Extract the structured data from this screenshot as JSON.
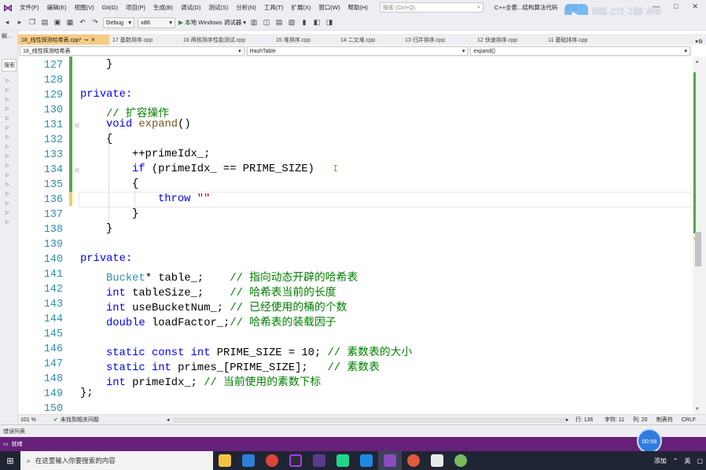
{
  "menubar": {
    "items": [
      "文件(F)",
      "编辑(E)",
      "视图(V)",
      "Git(G)",
      "项目(P)",
      "生成(B)",
      "调试(D)",
      "测试(S)",
      "分析(N)",
      "工具(T)",
      "扩展(X)",
      "窗口(W)",
      "帮助(H)"
    ],
    "search_placeholder": "搜索 (Ctrl+Q)",
    "solution": "C++全套...结构算法代码",
    "login": "登录",
    "window_buttons": [
      "—",
      "□",
      "✕"
    ]
  },
  "brand": {
    "text": "腾讯课堂"
  },
  "toolbar": {
    "config": "Debug",
    "platform": "x86",
    "run_label": "本地 Windows 调试器"
  },
  "tabs": [
    {
      "label": "18_线性探测哈希表.cpp*",
      "active": true
    },
    {
      "label": "17 基数排序.cpp"
    },
    {
      "label": "16 两核排序性能测试.cpp"
    },
    {
      "label": "15 堆排序.cpp"
    },
    {
      "label": "14 二叉堆.cpp"
    },
    {
      "label": "13 归并排序.cpp"
    },
    {
      "label": "12 快速排序.cpp"
    },
    {
      "label": "11 基础排序.cpp"
    }
  ],
  "navbar": {
    "project": "18_线性探测哈希表",
    "scope": "HashTable",
    "member": "expand()"
  },
  "leftpanel": {
    "title": "解...",
    "search": "搜索"
  },
  "line_numbers": [
    "127",
    "128",
    "129",
    "130",
    "131",
    "132",
    "133",
    "134",
    "135",
    "136",
    "137",
    "138",
    "139",
    "140",
    "141",
    "142",
    "143",
    "144",
    "145",
    "146",
    "147",
    "148",
    "149",
    "150"
  ],
  "code": {
    "l127": "}",
    "l129": "private:",
    "l130": "// 扩容操作",
    "l131_kw": "void",
    "l131_fn": "expand",
    "l131_rest": "()",
    "l132": "{",
    "l133": "++primeIdx_;",
    "l134_kw": "if",
    "l134_rest": " (primeIdx_ == PRIME_SIZE)",
    "l135": "{",
    "l136_kw": "throw",
    "l136_str": "\"\"",
    "l137": "}",
    "l138": "}",
    "l140": "private:",
    "l141_type": "Bucket",
    "l141_rest": "* table_;",
    "l141_cm": "// 指向动态开辟的哈希表",
    "l142_kw": "int",
    "l142_rest": " tableSize_;",
    "l142_cm": "// 哈希表当前的长度",
    "l143_kw": "int",
    "l143_rest": " useBucketNum_;",
    "l143_cm": "// 已经使用的桶的个数",
    "l144_kw": "double",
    "l144_rest": " loadFactor_;",
    "l144_cm": "// 哈希表的装载因子",
    "l146_kw": "static const int",
    "l146_rest": " PRIME_SIZE = 10;",
    "l146_cm": "// 素数表的大小",
    "l147_kw": "static int",
    "l147_rest": " primes_[PRIME_SIZE];",
    "l147_cm": "// 素数表",
    "l148_kw": "int",
    "l148_rest": " primeIdx_;",
    "l148_cm": "// 当前使用的素数下标",
    "l149": "};"
  },
  "editor_status": {
    "zoom": "101 %",
    "issues": "未找到相关问题",
    "line": "行: 136",
    "char": "字符: 11",
    "col": "列: 20",
    "tabs": "制表符",
    "eol": "CRLF"
  },
  "errlist": {
    "label": "错误列表"
  },
  "status": {
    "text": "就绪"
  },
  "timer": {
    "text": "00:58"
  },
  "taskbar": {
    "search_placeholder": "在这里输入你要搜索的内容",
    "tray_add": "添加",
    "tray_lang": "英"
  },
  "colors": {
    "vs_purple": "#68217a",
    "keyword": "#0000ff",
    "comment": "#008000",
    "type": "#2b91af",
    "string": "#a31515",
    "function": "#74531f"
  }
}
